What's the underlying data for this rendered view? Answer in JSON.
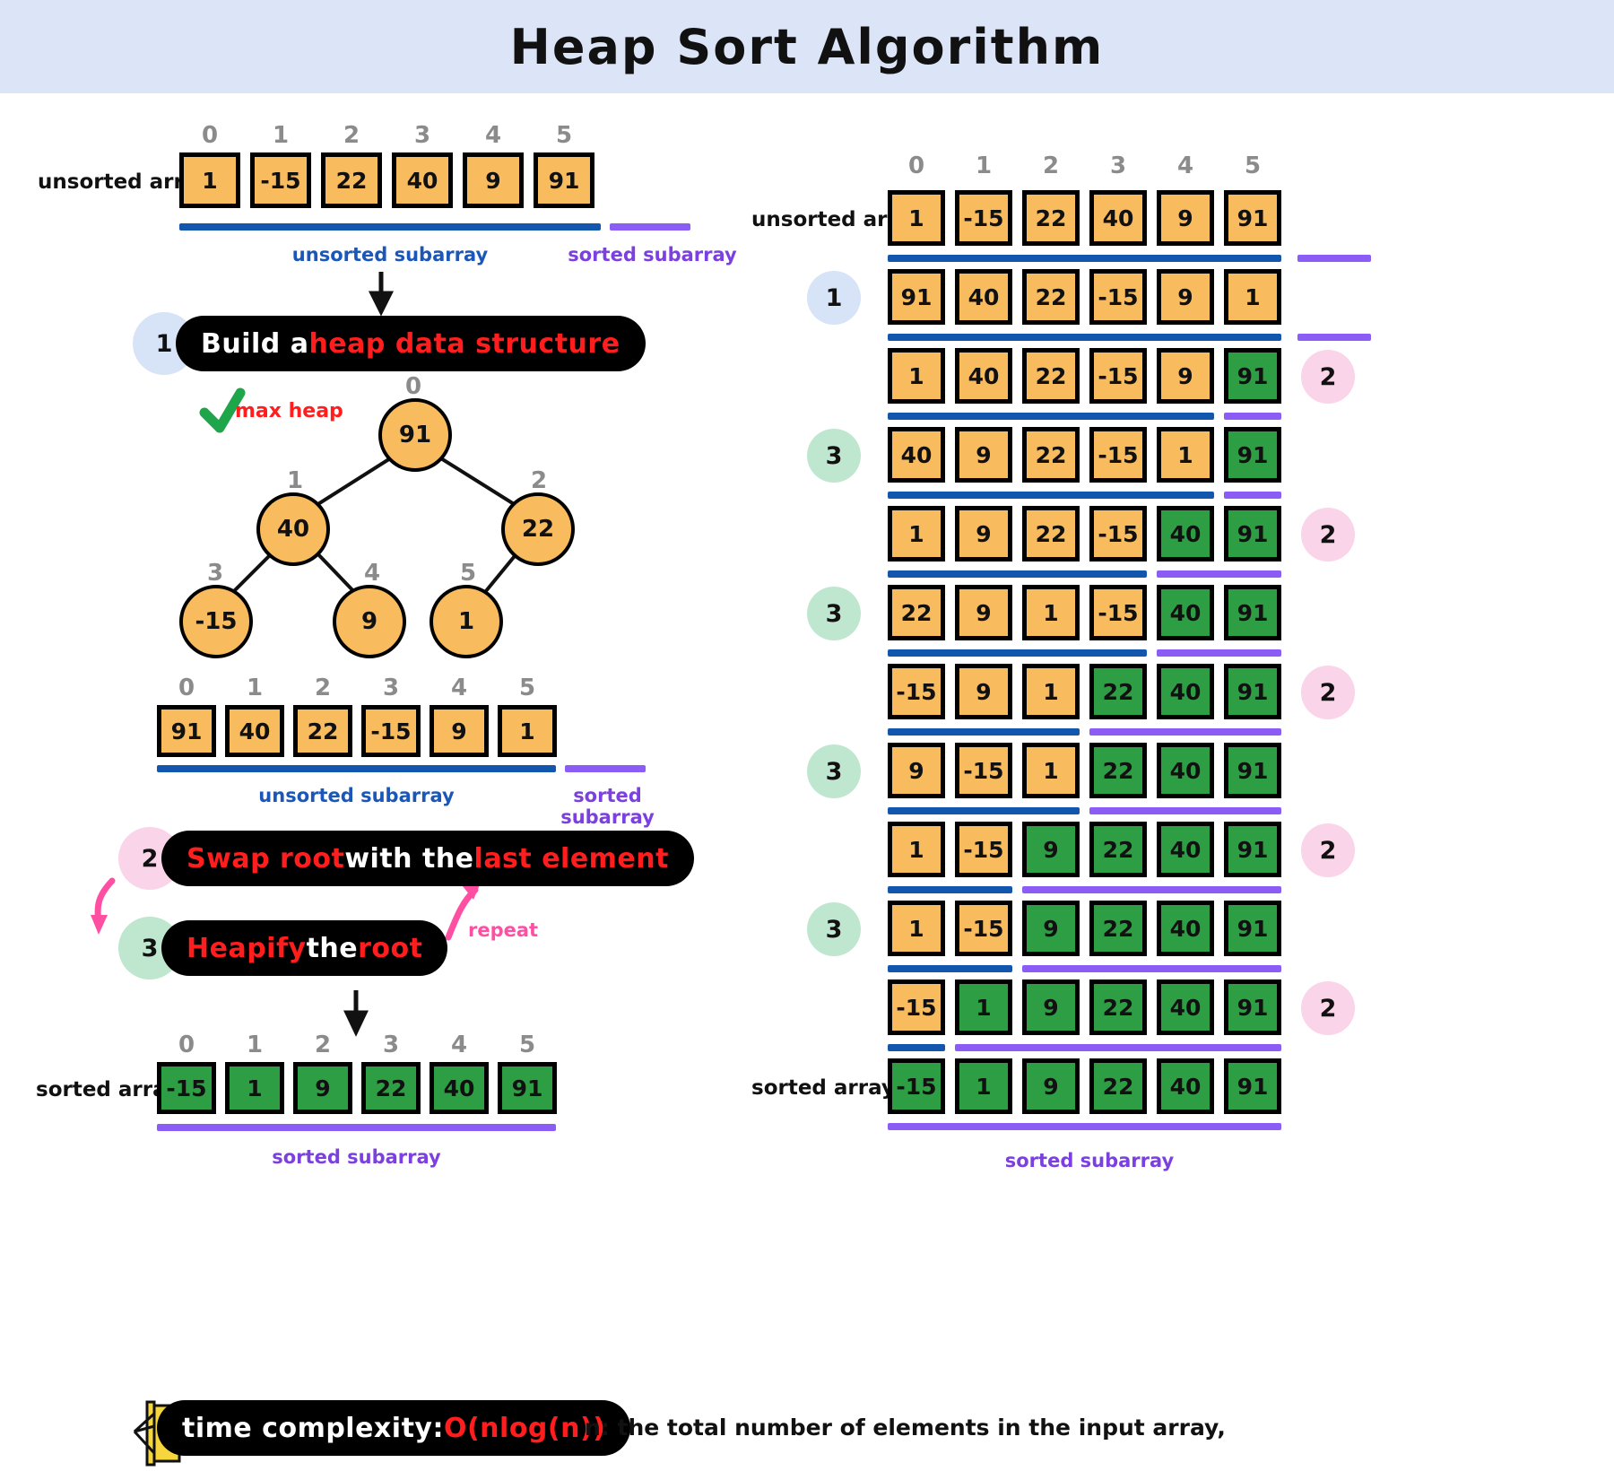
{
  "header": {
    "title": "Heap Sort Algorithm"
  },
  "labels": {
    "unsorted_array": "unsorted array",
    "sorted_array": "sorted array",
    "unsorted_subarray": "unsorted subarray",
    "sorted_subarray": "sorted subarray",
    "max_heap": "max heap",
    "repeat": "repeat"
  },
  "indices": [
    "0",
    "1",
    "2",
    "3",
    "4",
    "5"
  ],
  "colors": {
    "orange": "#f8bc5e",
    "green": "#2e9e45",
    "blue_bar": "#1257ad",
    "purple_bar": "#8b5cf6",
    "red_text": "#ff1d1d",
    "badge_blue": "#d7e3f7",
    "badge_pink": "#fad4e8",
    "badge_green": "#bfe6ce",
    "header_bg": "#dbe5f7",
    "pink_arrow": "#ff4fa3",
    "check_green": "#1fa54a"
  },
  "left": {
    "input_row": {
      "label": "unsorted array",
      "values": [
        "1",
        "-15",
        "22",
        "40",
        "9",
        "91"
      ],
      "unsorted_count": 6,
      "sorted_count": 0
    },
    "step1": {
      "number": "1",
      "text_plain": "Build a ",
      "text_highlight": "heap data structure"
    },
    "max_heap_note": "max heap",
    "tree": {
      "nodes": [
        {
          "index": "0",
          "value": "91"
        },
        {
          "index": "1",
          "value": "40"
        },
        {
          "index": "2",
          "value": "22"
        },
        {
          "index": "3",
          "value": "-15"
        },
        {
          "index": "4",
          "value": "9"
        },
        {
          "index": "5",
          "value": "1"
        }
      ]
    },
    "heap_row": {
      "values": [
        "91",
        "40",
        "22",
        "-15",
        "9",
        "1"
      ],
      "unsorted_count": 6,
      "sorted_count": 0
    },
    "step2": {
      "number": "2",
      "parts": [
        {
          "t": "Swap root",
          "hl": true
        },
        {
          "t": " with the ",
          "hl": false
        },
        {
          "t": "last element",
          "hl": true
        }
      ]
    },
    "step3": {
      "number": "3",
      "parts": [
        {
          "t": "Heapify",
          "hl": true
        },
        {
          "t": " the ",
          "hl": false
        },
        {
          "t": "root",
          "hl": true
        }
      ]
    },
    "output_row": {
      "label": "sorted array",
      "values": [
        "-15",
        "1",
        "9",
        "22",
        "40",
        "91"
      ],
      "sorted": true
    }
  },
  "right": {
    "rows": [
      {
        "label": "unsorted array",
        "badge": null,
        "badge_side": null,
        "values": [
          "1",
          "-15",
          "22",
          "40",
          "9",
          "91"
        ],
        "green_from": 6
      },
      {
        "label": "",
        "badge": "1",
        "badge_side": "left",
        "values": [
          "91",
          "40",
          "22",
          "-15",
          "9",
          "1"
        ],
        "green_from": 6
      },
      {
        "label": "",
        "badge": "2",
        "badge_side": "right",
        "values": [
          "1",
          "40",
          "22",
          "-15",
          "9",
          "91"
        ],
        "green_from": 5
      },
      {
        "label": "",
        "badge": "3",
        "badge_side": "left",
        "values": [
          "40",
          "9",
          "22",
          "-15",
          "1",
          "91"
        ],
        "green_from": 5
      },
      {
        "label": "",
        "badge": "2",
        "badge_side": "right",
        "values": [
          "1",
          "9",
          "22",
          "-15",
          "40",
          "91"
        ],
        "green_from": 4
      },
      {
        "label": "",
        "badge": "3",
        "badge_side": "left",
        "values": [
          "22",
          "9",
          "1",
          "-15",
          "40",
          "91"
        ],
        "green_from": 4
      },
      {
        "label": "",
        "badge": "2",
        "badge_side": "right",
        "values": [
          "-15",
          "9",
          "1",
          "22",
          "40",
          "91"
        ],
        "green_from": 3
      },
      {
        "label": "",
        "badge": "3",
        "badge_side": "left",
        "values": [
          "9",
          "-15",
          "1",
          "22",
          "40",
          "91"
        ],
        "green_from": 3
      },
      {
        "label": "",
        "badge": "2",
        "badge_side": "right",
        "values": [
          "1",
          "-15",
          "9",
          "22",
          "40",
          "91"
        ],
        "green_from": 2
      },
      {
        "label": "",
        "badge": "3",
        "badge_side": "left",
        "values": [
          "1",
          "-15",
          "9",
          "22",
          "40",
          "91"
        ],
        "green_from": 2
      },
      {
        "label": "",
        "badge": "2",
        "badge_side": "right",
        "values": [
          "-15",
          "1",
          "9",
          "22",
          "40",
          "91"
        ],
        "green_from": 1
      },
      {
        "label": "sorted array",
        "badge": null,
        "badge_side": null,
        "values": [
          "-15",
          "1",
          "9",
          "22",
          "40",
          "91"
        ],
        "green_from": 0
      }
    ],
    "bottom_caption": "sorted subarray"
  },
  "footer": {
    "complexity_plain": "time complexity: ",
    "complexity_value": "O(nlog(n))",
    "note": "n: the total number of elements in the input array,"
  }
}
